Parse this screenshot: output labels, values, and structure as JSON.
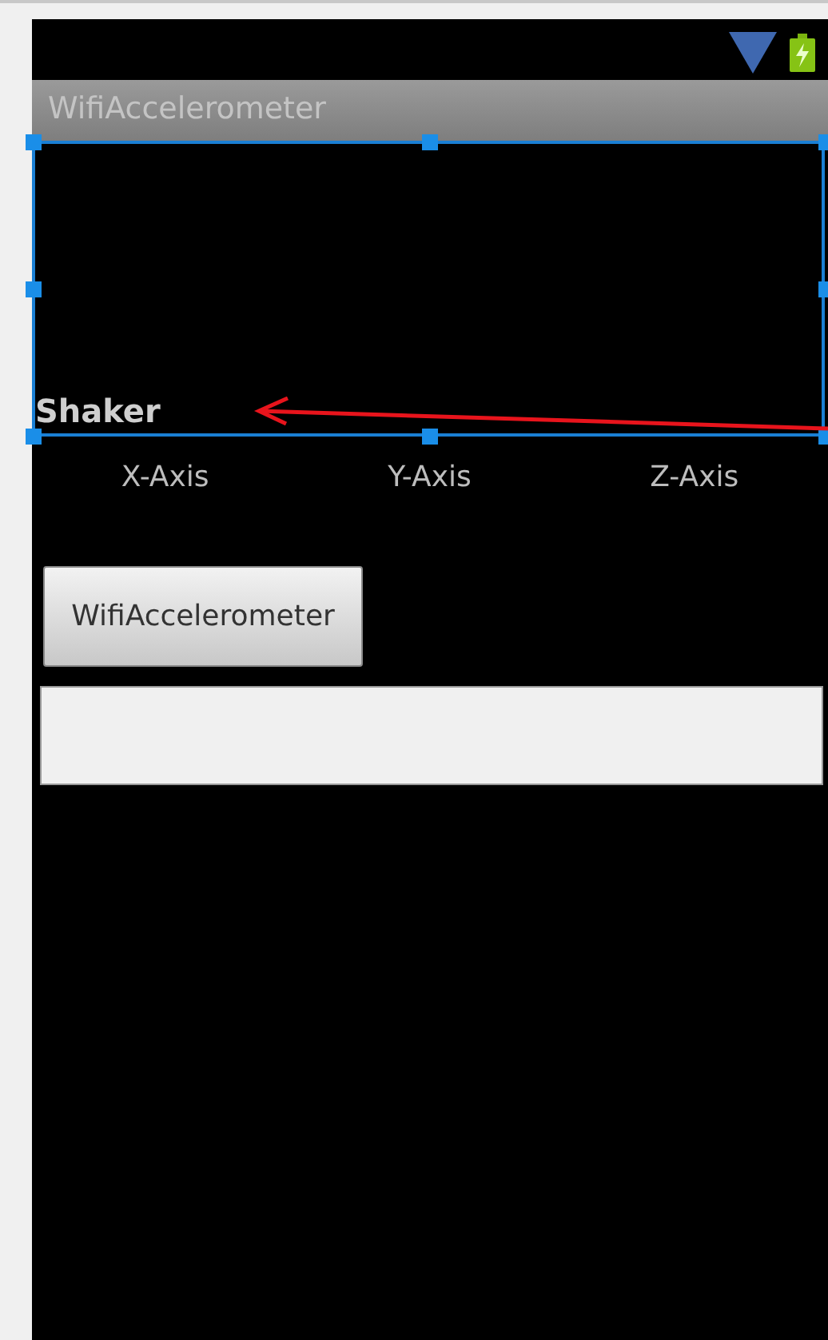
{
  "app_bar": {
    "title": "WifiAccelerometer"
  },
  "selected_view": {
    "label": "Shaker",
    "selected": true
  },
  "axis_labels": [
    "X-Axis",
    "Y-Axis",
    "Z-Axis"
  ],
  "button": {
    "label": "WifiAccelerometer"
  }
}
